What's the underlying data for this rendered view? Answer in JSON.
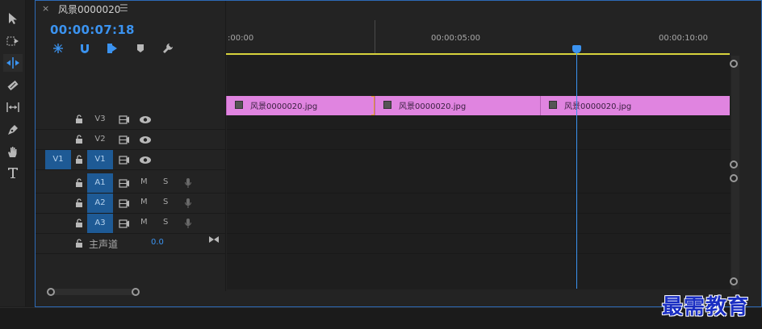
{
  "sequence": {
    "tab_close": "×",
    "title": "风景0000020",
    "menu": "☰",
    "timecode": "00:00:07:18"
  },
  "header_icons": [
    "nest-sequence-icon",
    "snap-icon",
    "linked-selection-icon",
    "add-marker-icon",
    "settings-wrench-icon"
  ],
  "ruler": {
    "labels": [
      ":00:00",
      "00:00:05:00",
      "00:00:10:00"
    ]
  },
  "tracks": {
    "video": [
      {
        "name": "V3",
        "targeted": false,
        "source": ""
      },
      {
        "name": "V2",
        "targeted": false,
        "source": ""
      },
      {
        "name": "V1",
        "targeted": true,
        "source": "V1"
      }
    ],
    "audio": [
      {
        "name": "A1",
        "m": "M",
        "s": "S"
      },
      {
        "name": "A2",
        "m": "M",
        "s": "S"
      },
      {
        "name": "A3",
        "m": "M",
        "s": "S"
      }
    ],
    "master": {
      "label": "主声道",
      "value": "0.0"
    }
  },
  "clips": [
    {
      "label": "风景0000020.jpg"
    },
    {
      "label": "风景0000020.jpg"
    },
    {
      "label": "风景0000020.jpg"
    }
  ],
  "tools": [
    "selection-tool-icon",
    "track-select-tool-icon",
    "ripple-edit-tool-icon",
    "razor-tool-icon",
    "slip-tool-icon",
    "pen-tool-icon",
    "hand-tool-icon",
    "type-tool-icon"
  ],
  "colors": {
    "accent": "#3b93f0",
    "clip": "#e084e0",
    "work_area": "#d7d23c",
    "track_target": "#1e5a95"
  },
  "watermark": "最需教育"
}
